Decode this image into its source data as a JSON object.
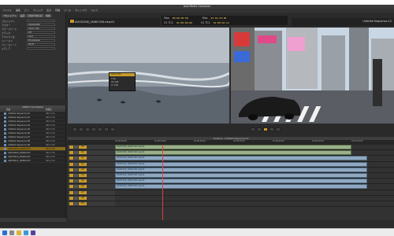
{
  "window": {
    "title": "Avid Media Composer"
  },
  "menu": [
    "ファイル",
    "編集",
    "ビン",
    "クリップ",
    "出力",
    "特殊",
    "ツール",
    "ウィンドウ",
    "ヘルプ"
  ],
  "composer": {
    "tc_labels": [
      "Mas",
      "V1 TC1",
      "Mas",
      "V1 TC1"
    ],
    "tc_values": [
      "00:00:00:00",
      "01:00:00:00",
      "01:01:23:06",
      "01:00:02:12"
    ],
    "source_clip": "A003C008_160817AH.new.01",
    "record_sequence": "Untitled Sequence.12"
  },
  "left_panel": {
    "tabs": [
      "プロジェクト",
      "設定",
      "フォーマット",
      "情報"
    ],
    "fields": [
      {
        "label": "プロジェクト",
        "value": ""
      },
      {
        "label": "ラスター",
        "value": "1920x1080"
      },
      {
        "label": "カラースペース",
        "value": "YCbCr 709"
      },
      {
        "label": "ステレオ",
        "value": "Off"
      },
      {
        "label": "アスペクト比",
        "value": "16:9"
      },
      {
        "label": "フィールド",
        "value": "Progressive"
      },
      {
        "label": "フレームレート",
        "value": "29.97"
      },
      {
        "label": "メディア",
        "value": ""
      }
    ]
  },
  "bin": {
    "title": "160817 Avid Media",
    "columns": [
      "名前",
      "作成日"
    ],
    "rows": [
      {
        "name": "Untitled Sequence.01",
        "date": "08/17/16",
        "selected": false
      },
      {
        "name": "Untitled Sequence.02",
        "date": "08/17/16",
        "selected": false
      },
      {
        "name": "Untitled Sequence.03",
        "date": "08/17/16",
        "selected": false
      },
      {
        "name": "Untitled Sequence.04",
        "date": "08/17/16",
        "selected": false
      },
      {
        "name": "Untitled Sequence.05",
        "date": "08/17/16",
        "selected": false
      },
      {
        "name": "Untitled Sequence.06",
        "date": "08/17/16",
        "selected": false
      },
      {
        "name": "Untitled Sequence.07",
        "date": "08/17/16",
        "selected": false
      },
      {
        "name": "Untitled Sequence.08",
        "date": "08/17/16",
        "selected": false
      },
      {
        "name": "Untitled Sequence.09",
        "date": "08/17/16",
        "selected": false
      },
      {
        "name": "A003C008_160817AH",
        "date": "08/17/16",
        "selected": true
      },
      {
        "name": "A003C009_160817AH",
        "date": "08/17/16",
        "selected": false
      },
      {
        "name": "A003C010_160817AH",
        "date": "08/17/16",
        "selected": false
      },
      {
        "name": "A003C011_160817AH",
        "date": "08/17/16",
        "selected": false
      }
    ]
  },
  "color_panel": {
    "title": "Color Info",
    "rows": [
      "Y 64",
      "Cb 128",
      "Cr 128"
    ]
  },
  "timeline": {
    "title": "Timeline - Untitled Sequence.12",
    "tracks": [
      "V2",
      "V1",
      "A1",
      "A2",
      "A3",
      "A4",
      "A5",
      "A6",
      "A7",
      "A8",
      "TC1"
    ],
    "clips": [
      "A003C008_160817AH.new.01",
      "A003C009_160817AH.new.01",
      "A003C010_160817AH.new.01",
      "A003C011_160817AH.new.01",
      "A003C012_160817AH.new.01",
      "A003C013_160817AH.new.01",
      "A003C014_160817AH.new.01",
      "A003C015_160817AH.new.01"
    ],
    "ruler": [
      "01:00:00:00",
      "01:00:10:00",
      "01:00:20:00",
      "01:00:30:00",
      "01:00:40:00",
      "01:00:50:00",
      "01:01:00:00"
    ]
  },
  "colors": {
    "accent": "#c79a2a",
    "video_clip": "#9bb08a",
    "audio_clip": "#8fa8c0"
  }
}
